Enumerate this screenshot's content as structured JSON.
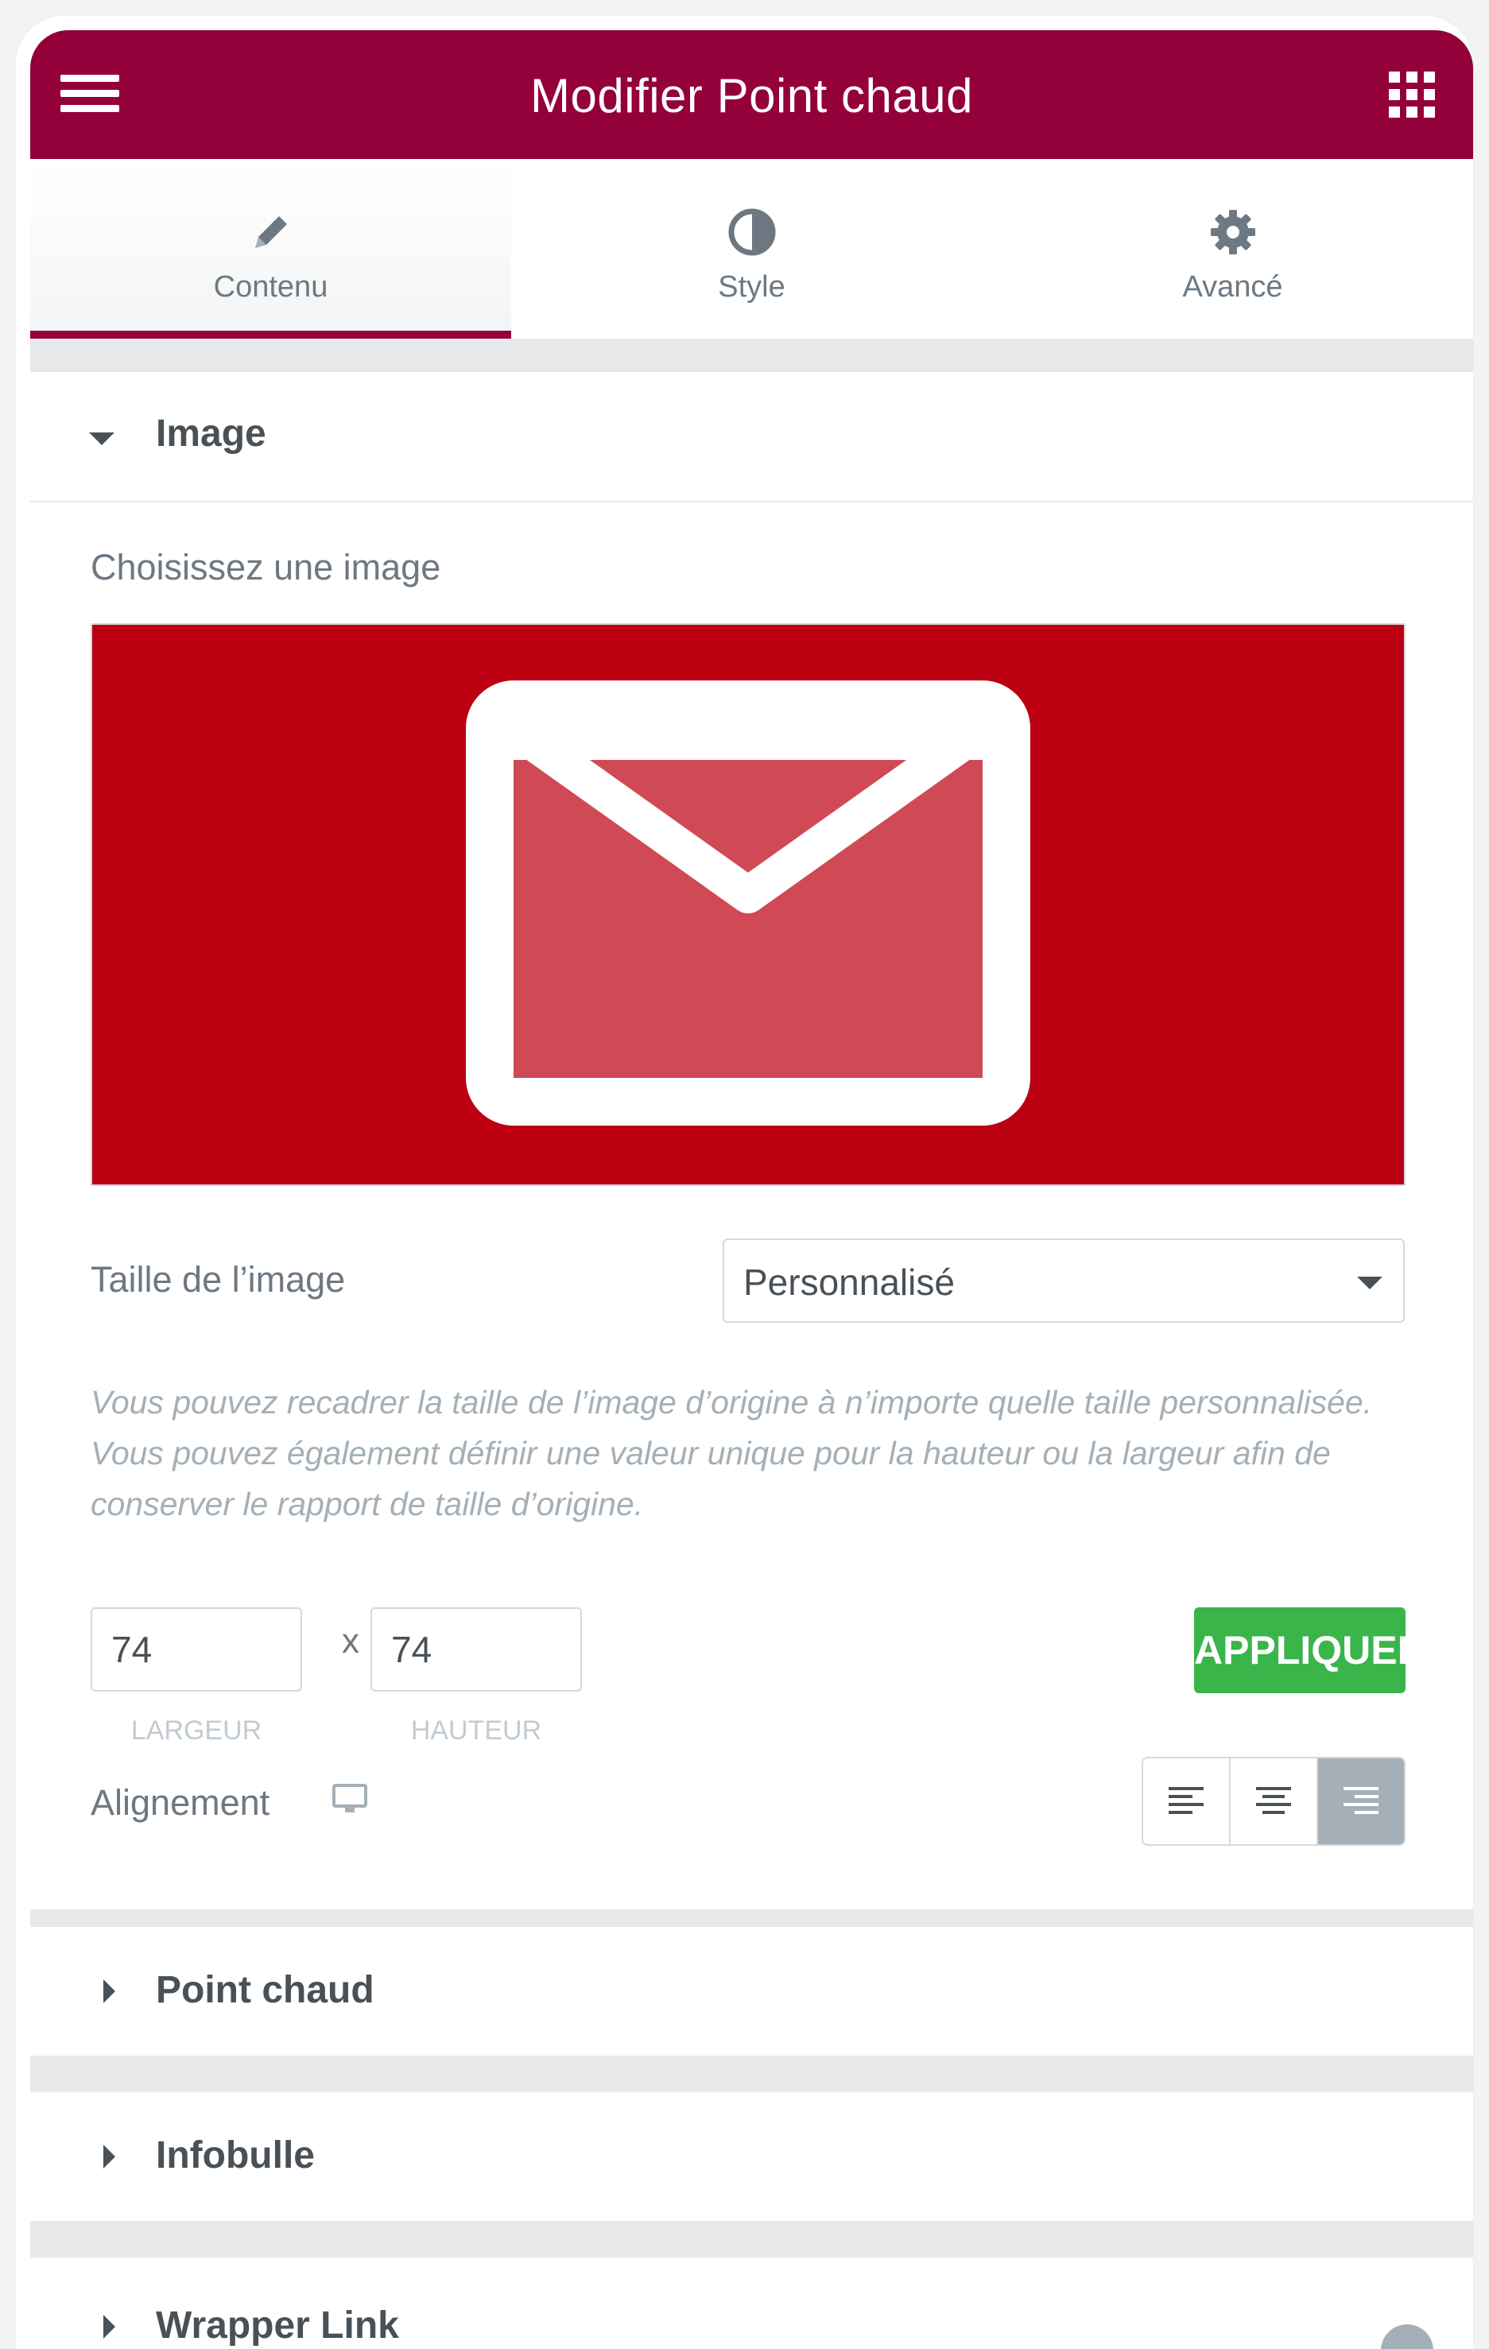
{
  "header": {
    "title": "Modifier Point chaud",
    "menu_icon": "hamburger-menu-icon",
    "apps_icon": "grid-apps-icon",
    "color": "#93003a"
  },
  "tabs": [
    {
      "label": "Contenu",
      "icon": "pencil-icon",
      "active": true
    },
    {
      "label": "Style",
      "icon": "contrast-icon",
      "active": false
    },
    {
      "label": "Avancé",
      "icon": "gear-icon",
      "active": false
    }
  ],
  "image_section": {
    "title": "Image",
    "choose_label": "Choisissez une image",
    "preview_icon": "envelope-icon",
    "preview_bg": "#bc0011",
    "size_label": "Taille de l’image",
    "size_value": "Personnalisé",
    "help_text": "Vous pouvez recadrer la taille de l’image d’origine à n’importe quelle taille personnalisée. Vous pouvez également définir une valeur unique pour la hauteur ou la largeur afin de conserver le rapport de taille d’origine.",
    "width_value": "74",
    "height_value": "74",
    "times": "x",
    "width_caption": "LARGEUR",
    "height_caption": "HAUTEUR",
    "apply_label": "APPLIQUER",
    "apply_color": "#39b54a",
    "alignment_label": "Alignement",
    "alignment_options": [
      "left",
      "center",
      "right"
    ],
    "alignment_selected": "right"
  },
  "sections": {
    "hotspot": "Point chaud",
    "tooltip": "Infobulle",
    "wrapper": "Wrapper Link"
  }
}
